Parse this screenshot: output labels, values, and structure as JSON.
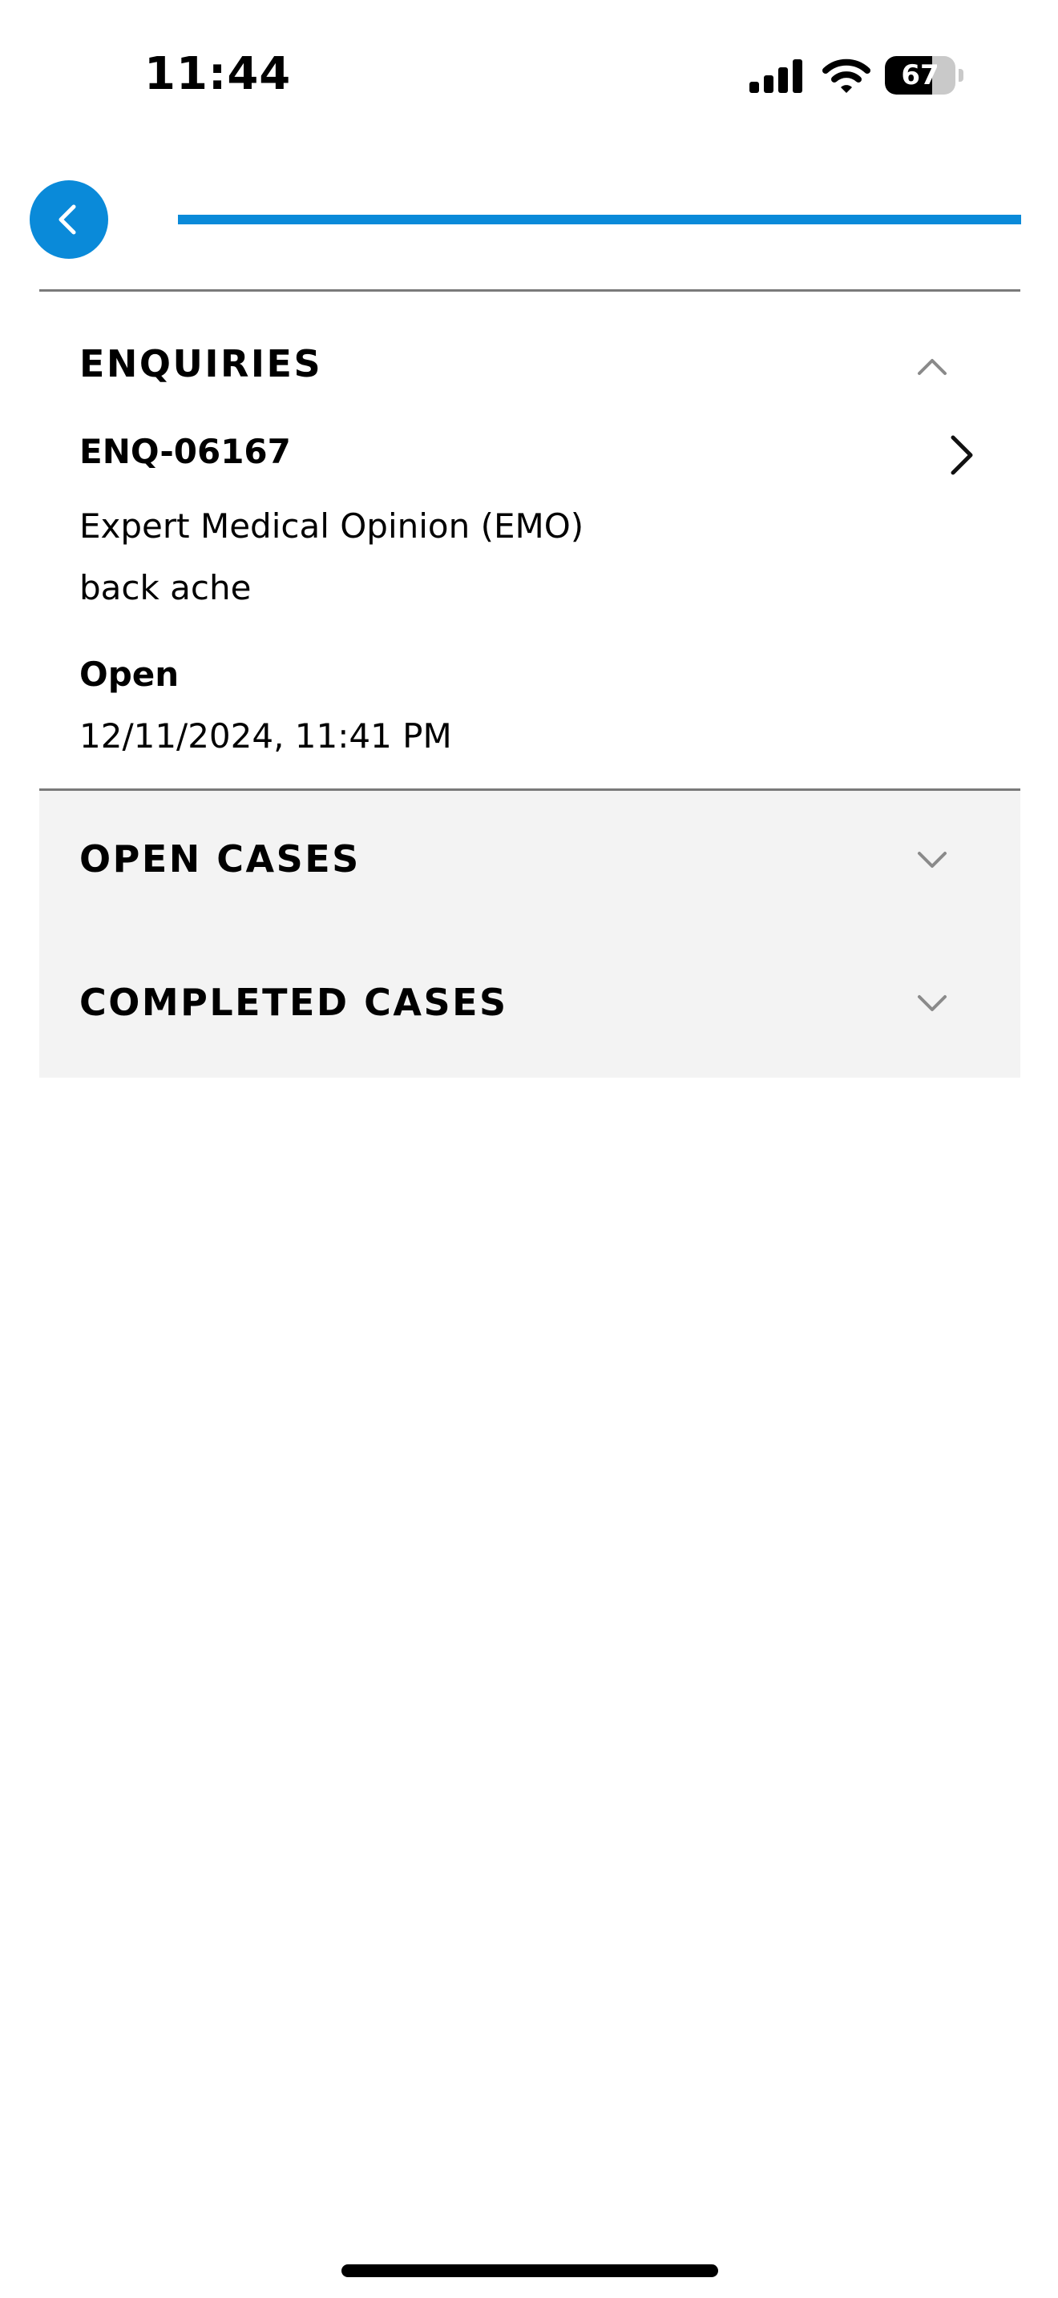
{
  "status_bar": {
    "time": "11:44",
    "battery": "67",
    "battery_level": 0.67,
    "icons": [
      "signal-icon",
      "wifi-icon",
      "battery-icon"
    ]
  },
  "nav": {
    "back_icon": "chevron-left-icon",
    "accent_color": "#0a8ad9"
  },
  "enquiries": {
    "title": "ENQUIRIES",
    "expanded": true,
    "items": [
      {
        "id": "ENQ-06167",
        "type": "Expert Medical Opinion (EMO)",
        "description": "back ache",
        "status": "Open",
        "date": "12/11/2024, 11:41 PM"
      }
    ]
  },
  "open_cases": {
    "title": "OPEN CASES",
    "expanded": false
  },
  "completed_cases": {
    "title": "COMPLETED CASES",
    "expanded": false
  },
  "colors": {
    "collapsed_background": "#f3f3f3",
    "divider": "#7a7a7a"
  }
}
